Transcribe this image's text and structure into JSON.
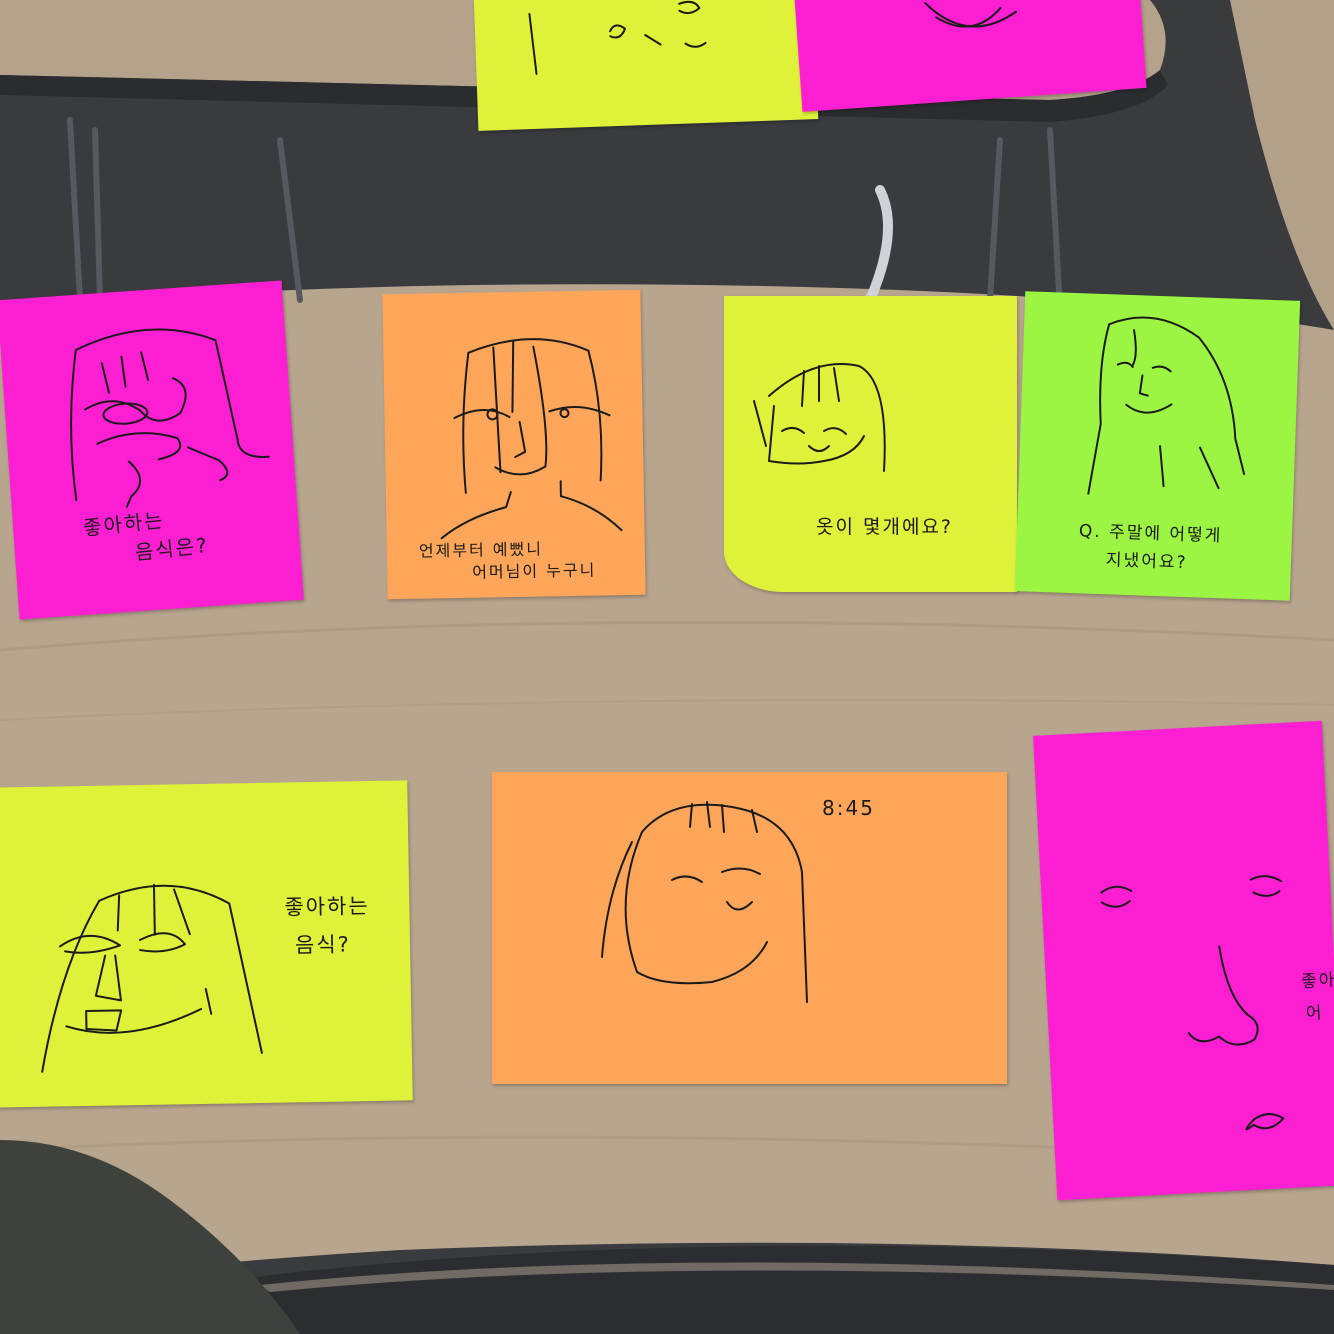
{
  "scene": {
    "description_colors": {
      "desk": "#b7a48d",
      "desk_edge": "#2f3033",
      "floor": "#3a3b3f",
      "note_pink": "#ff1fd2",
      "note_orange": "#ffa65a",
      "note_yellow": "#dff23a",
      "note_green": "#9cf542",
      "ink": "#1b1b1b"
    }
  },
  "notes": {
    "pink_top_left": {
      "caption_line1": "좋아하는",
      "caption_line2": "음식은?"
    },
    "orange_top": {
      "caption_line1": "언제부터 예뻤니",
      "caption_line2": "어머님이 누구니"
    },
    "yellow_top": {
      "caption_line1": "옷이 몇개에요?"
    },
    "green_top_right": {
      "caption_line1": "Q. 주말에 어떻게",
      "caption_line2": "지냈어요?"
    },
    "yellow_bottom_left": {
      "caption_line1": "좋아하는",
      "caption_line2": "음식?"
    },
    "orange_bottom": {
      "caption_line1": "8:45"
    },
    "pink_bottom_right": {
      "caption_line1": "좋아",
      "caption_line2": "어"
    }
  }
}
